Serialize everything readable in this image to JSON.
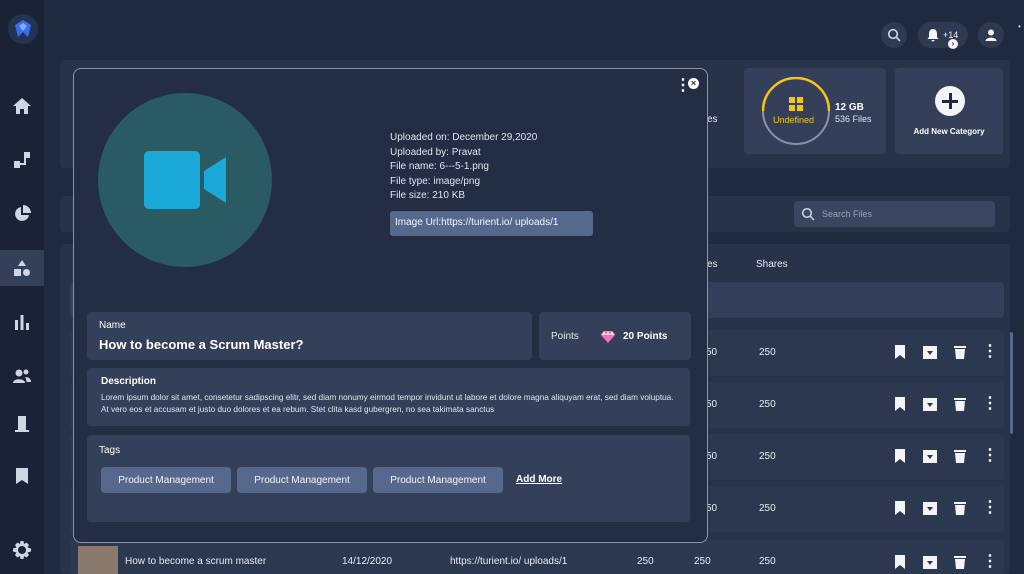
{
  "topbar": {
    "notification_count": "+14"
  },
  "storage_card": {
    "label": "Undefined",
    "size": "12 GB",
    "files": "536 Files"
  },
  "add_category": {
    "label": "Add New Category"
  },
  "partial_text": {
    "files_fragment": "es",
    "table_fragment": "es",
    "shares_header": "Shares"
  },
  "search": {
    "placeholder": "Search Files"
  },
  "rows": [
    {
      "col1": "50",
      "col2": "250"
    },
    {
      "col1": "50",
      "col2": "250"
    },
    {
      "col1": "50",
      "col2": "250"
    },
    {
      "col1": "50",
      "col2": "250"
    }
  ],
  "last_row": {
    "title": "How to become a scrum master",
    "date": "14/12/2020",
    "url": "https://turient.io/ uploads/1",
    "v1": "250",
    "v2": "250",
    "v3": "250"
  },
  "modal": {
    "uploaded_on": "Uploaded on: December 29,2020",
    "uploaded_by": "Uploaded by: Pravat",
    "file_name": "File name: 6---5-1.png",
    "file_type": "File type: image/png",
    "file_size": "File size: 210 KB",
    "image_url": "Image Url:https://turient.io/ uploads/1",
    "name_label": "Name",
    "name_value": "How to become a Scrum Master?",
    "points_label": "Points",
    "points_value": "20 Points",
    "description_label": "Description",
    "description_text": "Lorem ipsum dolor sit amet, consetetur sadipscing elitr, sed diam nonumy eirmod tempor invidunt ut labore et dolore magna aliquyam erat, sed diam voluptua. At vero eos et accusam et justo duo dolores et ea rebum. Stet clita kasd gubergren, no sea takimata sanctus",
    "tags_label": "Tags",
    "tags": [
      "Product Management",
      "Product Management",
      "Product Management"
    ],
    "add_more": "Add More"
  },
  "colors": {
    "background": "#1f2a3f",
    "sidebar": "#1a2336",
    "card": "#2c3850",
    "modal": "#232d44",
    "accent_yellow": "#f5c518",
    "video_icon": "#1aa8d8",
    "gem": "#f472b6"
  }
}
